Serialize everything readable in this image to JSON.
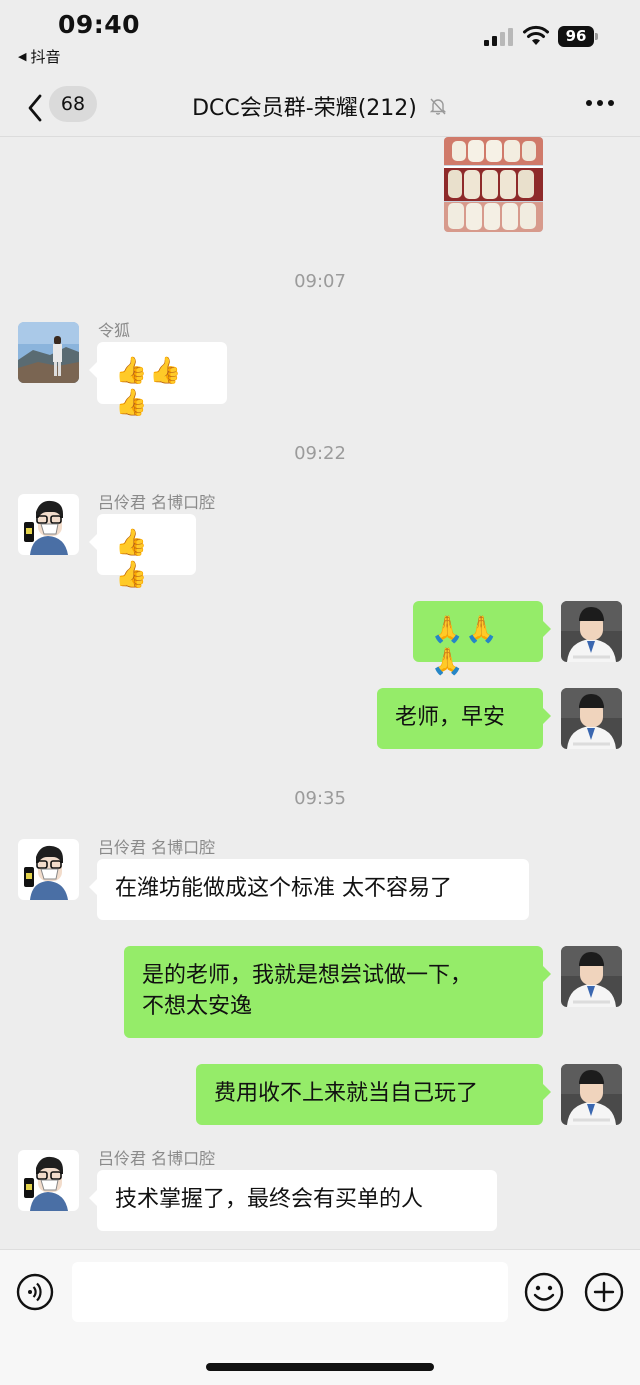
{
  "status_bar": {
    "time": "09:40",
    "back_app": "抖音",
    "battery": "96"
  },
  "nav": {
    "unread_count": "68",
    "title": "DCC会员群-荣耀(212)"
  },
  "messages": {
    "ts1": "09:07",
    "m1_sender": "令狐",
    "m1_text": "👍👍👍",
    "ts2": "09:22",
    "m2_sender": "吕伶君 名博口腔",
    "m2_text": "👍👍",
    "m3_text": "🙏🙏🙏",
    "m4_text": "老师，早安",
    "ts3": "09:35",
    "m5_sender": "吕伶君 名博口腔",
    "m5_text": "在潍坊能做成这个标准 太不容易了",
    "m6_line1": "是的老师，我就是想尝试做一下，",
    "m6_line2": "不想太安逸",
    "m7_text": "费用收不上来就当自己玩了",
    "m8_sender": "吕伶君 名博口腔",
    "m8_text": "技术掌握了，最终会有买单的人"
  },
  "colors": {
    "bubble_mine": "#95ec69",
    "bubble_other": "#ffffff",
    "background": "#ededed"
  },
  "icons": [
    "back-chevron-icon",
    "mute-bell-icon",
    "more-icon",
    "voice-icon",
    "emoji-icon",
    "plus-icon"
  ]
}
